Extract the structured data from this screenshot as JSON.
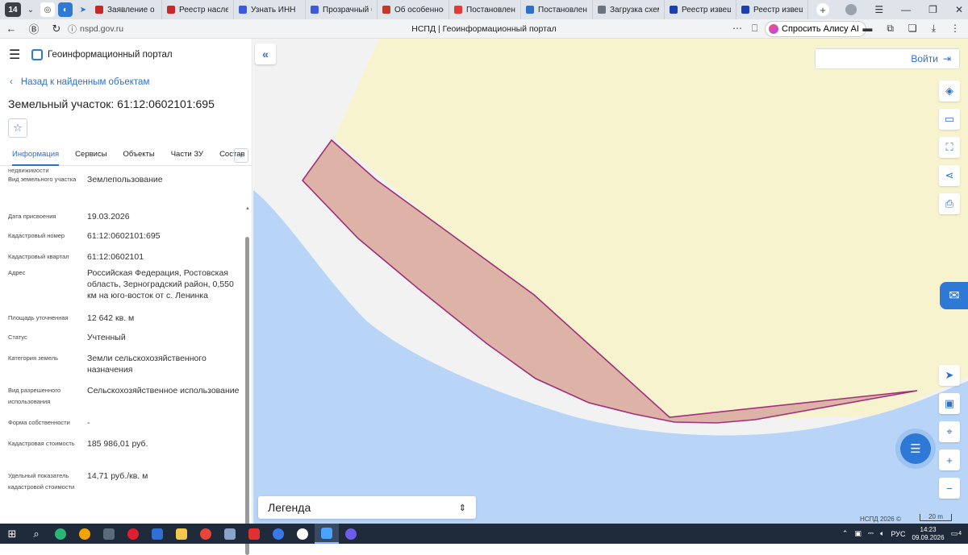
{
  "browser": {
    "tab_count": "14",
    "tabs": [
      {
        "label": "Заявление о пр",
        "color": "#c62828"
      },
      {
        "label": "Реестр наследс",
        "color": "#c62828"
      },
      {
        "label": "Узнать ИНН",
        "color": "#3b5bdb"
      },
      {
        "label": "Прозрачный би",
        "color": "#3b5bdb"
      },
      {
        "label": "Об особенност",
        "color": "#c0392b"
      },
      {
        "label": "Постановление",
        "color": "#e53935"
      },
      {
        "label": "Постановление",
        "color": "#2e6fc8"
      },
      {
        "label": "Загрузка схем р",
        "color": "#6b7280"
      },
      {
        "label": "Реестр извещен",
        "color": "#1e40af"
      },
      {
        "label": "Реестр извещен",
        "color": "#1e40af"
      }
    ],
    "url": "nspd.gov.ru",
    "page_title": "НСПД | Геоинформационный портал",
    "alice_label": "Спросить Алису AI"
  },
  "sidebar": {
    "app_title": "Геоинформационный портал",
    "back_link": "Назад к найденным объектам",
    "object_title": "Земельный участок: 61:12:0602101:695",
    "tabs": [
      "Информация",
      "Сервисы",
      "Объекты",
      "Части ЗУ",
      "Состав"
    ],
    "cut_label": "недвижимости",
    "properties": [
      {
        "key": "Вид земельного участка",
        "value": "Землепользование"
      },
      {
        "key": "Дата присвоения",
        "value": "19.03.2026"
      },
      {
        "key": "Кадастровый номер",
        "value": "61:12:0602101:695"
      },
      {
        "key": "Кадастровый квартал",
        "value": "61:12:0602101"
      },
      {
        "key": "Адрес",
        "value": "Российская Федерация, Ростовская область, Зерноградский район, 0,550 км на юго-восток от с. Ленинка"
      },
      {
        "key": "Площадь уточненная",
        "value": "12 642 кв. м"
      },
      {
        "key": "Статус",
        "value": "Учтенный"
      },
      {
        "key": "Категория земель",
        "value": "Земли сельскохозяйственного назначения"
      },
      {
        "key": "Вид разрешенного использования",
        "value": "Сельскохозяйственное использование"
      },
      {
        "key": "Форма собственности",
        "value": "-"
      },
      {
        "key": "Кадастровая стоимость",
        "value": "185 986,01 руб."
      },
      {
        "key": "Удельный показатель кадастровой стоимости",
        "value": "14,71 руб./кв. м"
      }
    ]
  },
  "map": {
    "login_label": "Войти",
    "legend_label": "Легенда",
    "copyright": "НСПД 2026 ©",
    "scale_label": "20 m",
    "colors": {
      "parcel_fill": "#dcb3a6",
      "parcel_stroke": "#a0307a",
      "field": "#f8f3cf",
      "water": "#b8d5f7"
    }
  },
  "taskbar": {
    "lang": "РУС",
    "time": "14:23",
    "date": "09.09.2026",
    "notifications": "4"
  }
}
